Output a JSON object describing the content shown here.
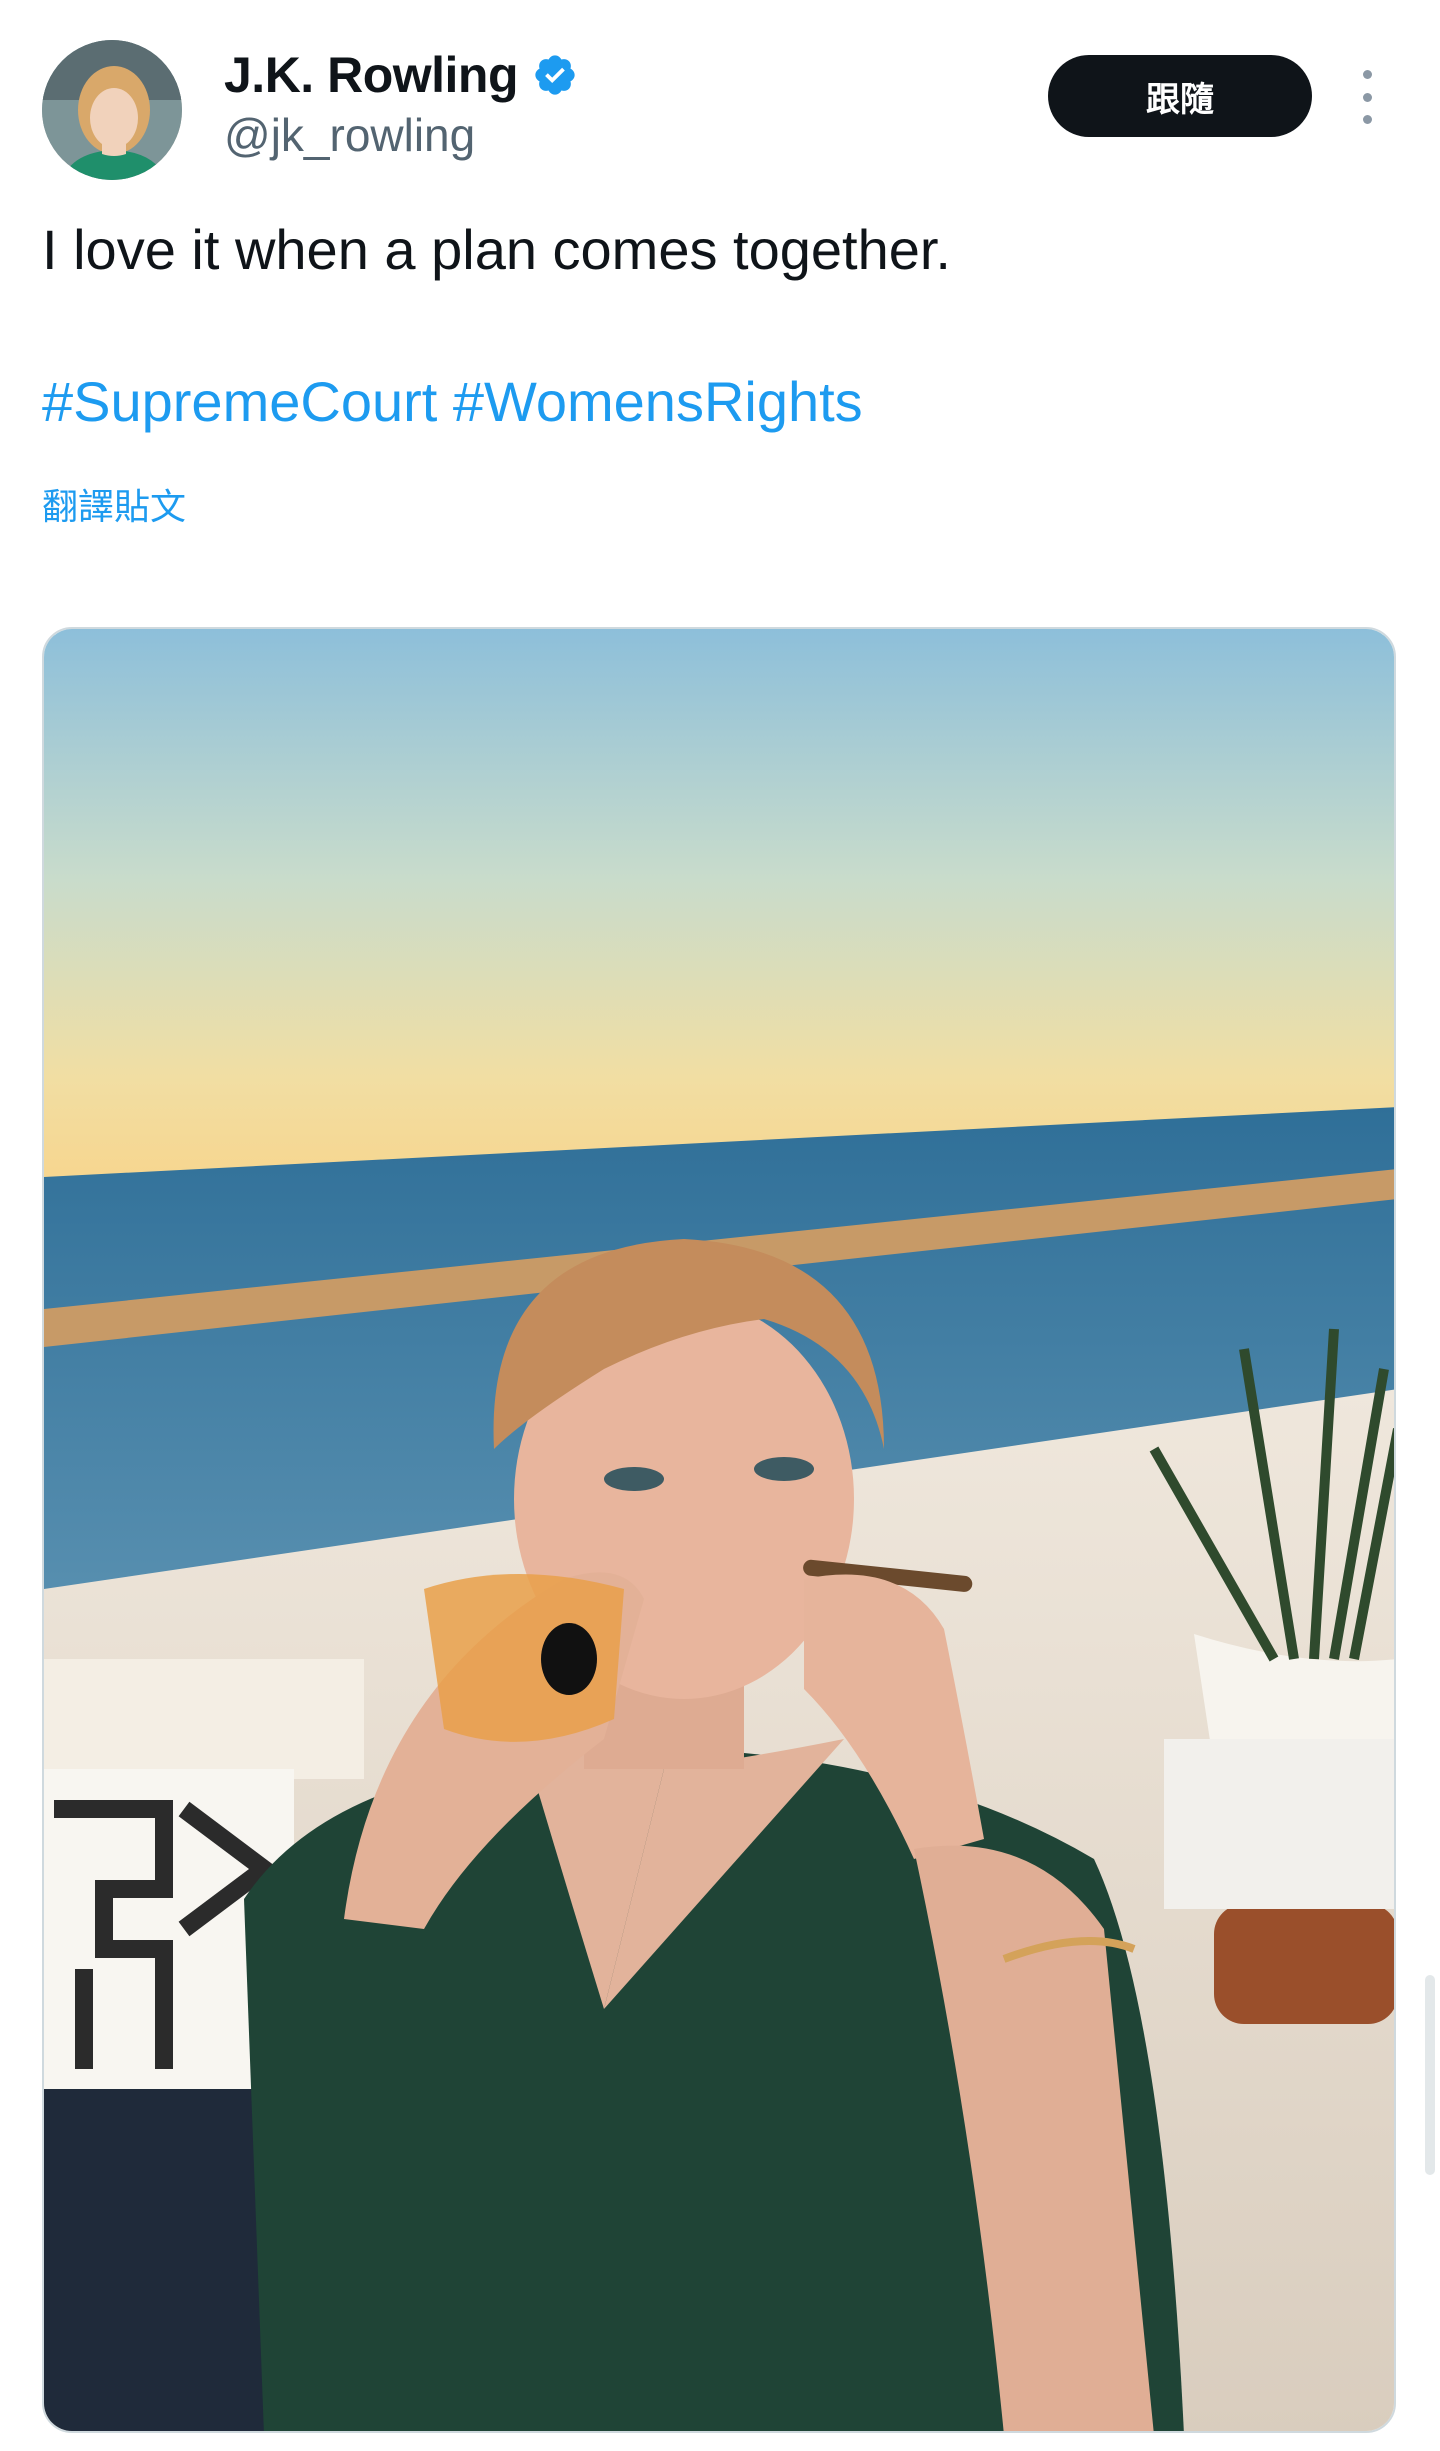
{
  "tweet": {
    "author": {
      "display_name": "J.K. Rowling",
      "handle": "@jk_rowling",
      "verified": true,
      "avatar_icon": "profile-photo"
    },
    "follow_label": "跟隨",
    "more_icon": "more-options-icon",
    "text": "I love it when a plan comes together.",
    "hashtags": [
      "#SupremeCourt",
      "#WomensRights"
    ],
    "translate_label": "翻譯貼文",
    "media_icon": "photo"
  },
  "colors": {
    "accent": "#1d9bf0",
    "text_primary": "#0f1419",
    "text_secondary": "#536471",
    "button_bg": "#0f1419",
    "button_text": "#ffffff"
  }
}
